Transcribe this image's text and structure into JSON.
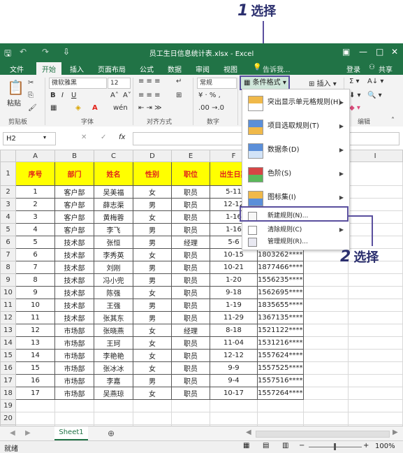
{
  "callouts": {
    "step1": {
      "num": "1",
      "text": "选择"
    },
    "step2": {
      "num": "2",
      "text": "选择"
    }
  },
  "window": {
    "title": "员工生日信息统计表.xlsx - Excel",
    "login": "登录",
    "share": "共享"
  },
  "tabs": [
    "文件",
    "开始",
    "插入",
    "页面布局",
    "公式",
    "数据",
    "审阅",
    "视图"
  ],
  "tell_me": "告诉我...",
  "ribbon": {
    "paste": "粘贴",
    "clipboard": "剪贴板",
    "font_name": "微软雅黑",
    "font_size": "12",
    "font_group": "字体",
    "align_group": "对齐方式",
    "number_format": "常规",
    "number_group": "数字",
    "cond_format": "条件格式",
    "insert": "插入",
    "edit_group": "编辑"
  },
  "name_box": "H2",
  "columns": [
    "A",
    "B",
    "C",
    "D",
    "E",
    "F",
    "G",
    "H",
    "I"
  ],
  "headers": [
    "序号",
    "部门",
    "姓名",
    "性别",
    "职位",
    "出生日期",
    ""
  ],
  "rows": [
    [
      "1",
      "客户部",
      "吴美福",
      "女",
      "职员",
      "5-11",
      ""
    ],
    [
      "2",
      "客户部",
      "薛志渠",
      "男",
      "职员",
      "12-12",
      ""
    ],
    [
      "3",
      "客户部",
      "黄梅蓉",
      "女",
      "职员",
      "1-16",
      ""
    ],
    [
      "4",
      "客户部",
      "李飞",
      "男",
      "职员",
      "1-16",
      ""
    ],
    [
      "5",
      "技术部",
      "张恒",
      "男",
      "经理",
      "5-6",
      ""
    ],
    [
      "6",
      "技术部",
      "李秀英",
      "女",
      "职员",
      "10-15",
      "1803262****"
    ],
    [
      "7",
      "技术部",
      "刘刚",
      "男",
      "职员",
      "10-21",
      "1877466****"
    ],
    [
      "8",
      "技术部",
      "冯小兜",
      "男",
      "职员",
      "1-20",
      "1556235****"
    ],
    [
      "9",
      "技术部",
      "陈强",
      "女",
      "职员",
      "9-18",
      "1562695****"
    ],
    [
      "10",
      "技术部",
      "王强",
      "男",
      "职员",
      "1-19",
      "1835655****"
    ],
    [
      "11",
      "技术部",
      "张其东",
      "男",
      "职员",
      "11-29",
      "1367135****"
    ],
    [
      "12",
      "市场部",
      "张晓燕",
      "女",
      "经理",
      "8-18",
      "1521122****"
    ],
    [
      "13",
      "市场部",
      "王珂",
      "女",
      "职员",
      "11-04",
      "1531216****"
    ],
    [
      "14",
      "市场部",
      "李艳艳",
      "女",
      "职员",
      "12-12",
      "1557624****"
    ],
    [
      "15",
      "市场部",
      "张冰冰",
      "女",
      "职员",
      "9-9",
      "1557525****"
    ],
    [
      "16",
      "市场部",
      "李嘉",
      "男",
      "职员",
      "9-4",
      "1557516****"
    ],
    [
      "17",
      "市场部",
      "吴燕琼",
      "女",
      "职员",
      "10-17",
      "1557264****"
    ]
  ],
  "menu": {
    "items": [
      {
        "label": "突出显示单元格规则(H)",
        "icon": "highlight-rules-icon"
      },
      {
        "label": "项目选取规则(T)",
        "icon": "top-bottom-rules-icon"
      },
      {
        "label": "数据条(D)",
        "icon": "data-bars-icon"
      },
      {
        "label": "色阶(S)",
        "icon": "color-scales-icon"
      },
      {
        "label": "图标集(I)",
        "icon": "icon-sets-icon"
      }
    ],
    "new_rule": "新建规则(N)...",
    "clear_rules": "清除规则(C)",
    "manage_rules": "管理规则(R)..."
  },
  "sheet_tab": "Sheet1",
  "status": "就绪",
  "zoom": "100%",
  "colors": {
    "excel_green": "#217346",
    "header_fill": "#ffff00",
    "header_text": "#e2231a",
    "callout": "#5a4f9e"
  }
}
